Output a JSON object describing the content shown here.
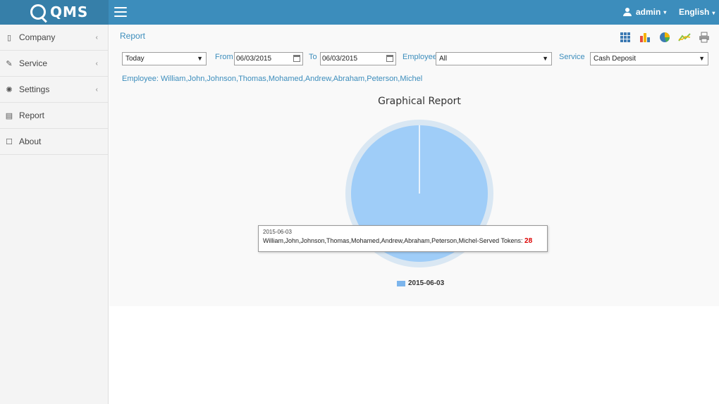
{
  "header": {
    "logo_text": "QMS",
    "user_label": "admin",
    "language_label": "English"
  },
  "sidebar": {
    "items": [
      {
        "label": "Company",
        "icon": "building-icon"
      },
      {
        "label": "Service",
        "icon": "wrench-icon"
      },
      {
        "label": "Settings",
        "icon": "gear-icon"
      },
      {
        "label": "Report",
        "icon": "document-icon"
      },
      {
        "label": "About",
        "icon": "edit-icon"
      }
    ]
  },
  "main": {
    "title": "Report",
    "toolbar_icons": [
      "table-icon",
      "bar-chart-icon",
      "pie-chart-icon",
      "line-chart-icon",
      "print-icon"
    ],
    "filters": {
      "period_value": "Today",
      "from_label": "From",
      "from_value": "06/03/2015",
      "to_label": "To",
      "to_value": "06/03/2015",
      "employee_label": "Employee",
      "employee_value": "All",
      "service_label": "Service",
      "service_value": "Cash Deposit"
    },
    "employee_line": "Employee: William,John,Johnson,Thomas,Mohamed,Andrew,Abraham,Peterson,Michel",
    "tooltip": {
      "date": "2015-06-03",
      "text": "William,John,Johnson,Thomas,Mohamed,Andrew,Abraham,Peterson,Michel-Served Tokens:",
      "value": "28"
    }
  },
  "chart_data": {
    "type": "pie",
    "title": "Graphical Report",
    "categories": [
      "2015-06-03"
    ],
    "values": [
      28
    ],
    "colors": [
      "#7cb5ec"
    ],
    "legend": "bottom"
  }
}
